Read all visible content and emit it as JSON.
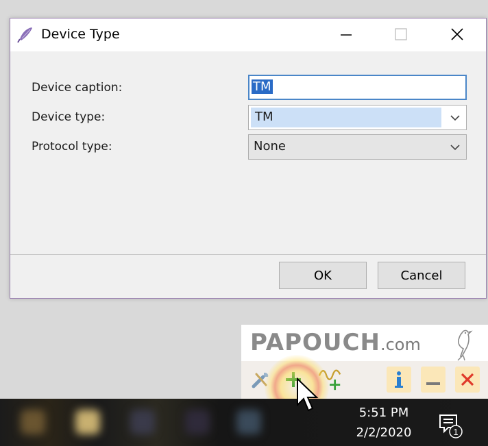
{
  "dialog": {
    "title": "Device Type",
    "fields": {
      "caption": {
        "label": "Device caption:",
        "value": "TM"
      },
      "device_type": {
        "label": "Device type:",
        "value": "TM"
      },
      "protocol_type": {
        "label": "Protocol type:",
        "value": "None"
      }
    },
    "buttons": {
      "ok": "OK",
      "cancel": "Cancel"
    },
    "icons": {
      "app": "feather-pen-icon",
      "minimize": "minimize-icon",
      "maximize": "maximize-icon",
      "close": "close-icon"
    }
  },
  "papouch": {
    "brand": "PAPOUCH",
    "brand_suffix": ".com",
    "tools": [
      "tools-icon",
      "add-icon",
      "add-graph-icon",
      "info-icon",
      "minimize-icon",
      "close-icon"
    ],
    "colors": {
      "add": "#3aa23a",
      "info": "#2a7fd0",
      "close": "#e03a2a",
      "button_bg": "#fbe7b8"
    }
  },
  "taskbar": {
    "time": "5:51 PM",
    "date": "2/2/2020",
    "notification_count": "1"
  }
}
